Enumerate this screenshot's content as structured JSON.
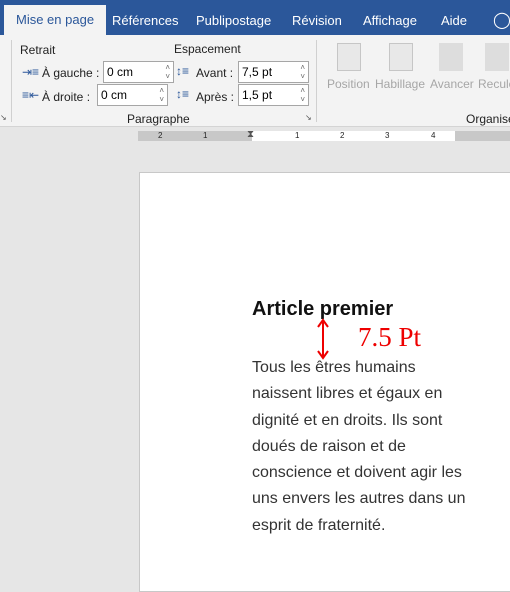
{
  "tabs": [
    {
      "label": "Mise en page",
      "active": true
    },
    {
      "label": "Références"
    },
    {
      "label": "Publipostage"
    },
    {
      "label": "Révision"
    },
    {
      "label": "Affichage"
    },
    {
      "label": "Aide"
    }
  ],
  "paragraph": {
    "group_label": "Paragraphe",
    "retrait_label": "Retrait",
    "espacement_label": "Espacement",
    "gauche_label": "À gauche :",
    "gauche_value": "0 cm",
    "droite_label": "À droite :",
    "droite_value": "0 cm",
    "avant_label": "Avant :",
    "avant_value": "7,5 pt",
    "apres_label": "Après :",
    "apres_value": "1,5 pt"
  },
  "organiser": {
    "group_label": "Organiser",
    "buttons": [
      "Position",
      "Habillage",
      "Avancer",
      "Reculer"
    ]
  },
  "ruler": {
    "ticks": [
      "2",
      "1",
      "1",
      "2",
      "3",
      "4"
    ]
  },
  "document": {
    "heading": "Article premier",
    "annotation": "7.5 Pt",
    "annotation_color": "#e00000",
    "body": "Tous les êtres humains naissent libres et égaux en dignité et en droits. Ils sont doués de raison et de conscience et doivent agir les uns envers les autres dans un esprit de fraternité."
  },
  "colors": {
    "ribbon_tab_bar": "#2b579a"
  }
}
